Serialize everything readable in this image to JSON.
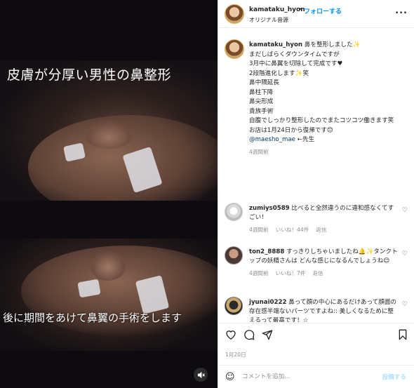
{
  "media": {
    "title": "皮膚が分厚い男性の鼻整形",
    "caption": "後に期間をあけて鼻翼の手術をします",
    "mute_icon": "speaker-muted"
  },
  "header": {
    "username": "kamataku_hyon",
    "dot": "•",
    "follow": "フォローする",
    "audio": "オリジナル音源",
    "more": "..."
  },
  "caption": {
    "username": "kamataku_hyon",
    "lines": [
      "鼻を整形しました✨",
      "",
      "まだしばらくダウンタイムですが",
      "3月中に鼻翼を切除して完成です♥",
      "2段階進化します✨笑",
      "",
      "鼻中隔延長",
      "鼻柱下降",
      "鼻尖形成",
      "貴族手術",
      "",
      "自腹でしっかり整形したのでまたコツコツ働きます笑",
      "お店は1月24日から復帰です😊",
      ""
    ],
    "mention": "@maesho_mae",
    "mention_suffix": " ←先生",
    "time": "4週間前"
  },
  "comments": [
    {
      "username": "zumiys0589",
      "text": "比べると全然違うのに違和感なくてすごい！",
      "time": "4週間前",
      "likes": "いいね！44件",
      "reply": "返信"
    },
    {
      "username": "ton2_8888",
      "text": "すっきりしちゃいましたね🔔✨タンクトップの妖精さんは どんな感じになるんでしょうね😊",
      "time": "4週間前",
      "likes": "いいね！7件",
      "reply": "返信"
    },
    {
      "username": "jyunai0222",
      "text": "鼻って顔の中心にあるだけあって顔面の存在感半端ないパーツですよね:: 美しくなるために整えるって最高です！☆",
      "time": "",
      "likes": "",
      "reply": ""
    }
  ],
  "actions": {
    "like_icon": "heart-outline",
    "comment_icon": "speech-bubble",
    "share_icon": "paper-plane",
    "save_icon": "bookmark-outline"
  },
  "post_date": "1月20日",
  "compose": {
    "placeholder": "コメントを追加...",
    "post": "投稿する"
  },
  "colors": {
    "accent": "#0095f6",
    "muted": "#8e8e8e",
    "media_bg": "#0d0b10"
  }
}
